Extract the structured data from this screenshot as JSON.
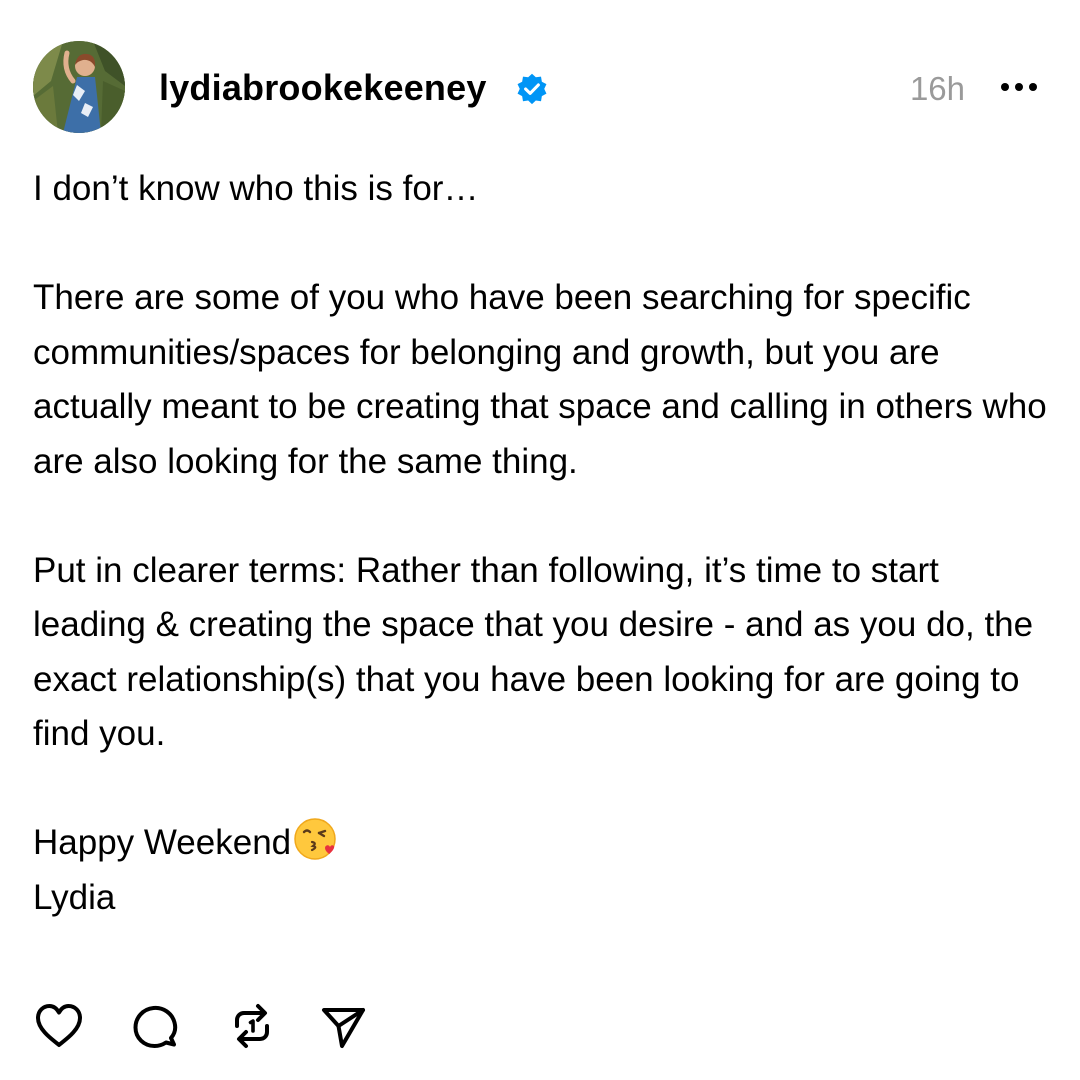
{
  "post": {
    "username": "lydiabrookekeeney",
    "verified": true,
    "timestamp": "16h",
    "paragraphs": [
      "I don’t know who this is for…",
      "There are some of you who have been searching for specific communities/spaces for belonging and growth, but you are actually meant to be creating that space and calling in others who are also looking for the same thing.",
      "Put in clearer terms: Rather than following, it’s time to start leading & creating the space that you desire - and as you do, the exact relationship(s) that you have been looking for are going to find you."
    ],
    "closing": "Happy Weekend",
    "closing_emoji": "kissing-face-emoji",
    "signature": "Lydia"
  },
  "icons": {
    "avatar": "profile-photo",
    "verified": "verified-badge-icon",
    "more": "more-options-icon",
    "like": "heart-icon",
    "reply": "comment-icon",
    "repost": "repost-icon",
    "share": "send-icon"
  },
  "colors": {
    "verified_blue": "#0095f6",
    "timestamp_gray": "#9a9a9a",
    "text": "#000000"
  }
}
